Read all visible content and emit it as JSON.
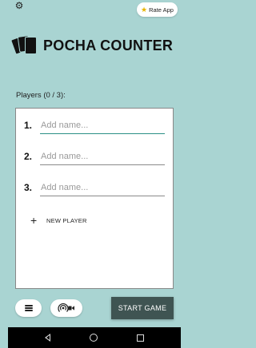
{
  "topbar": {
    "settings_icon": "gear-icon",
    "rate_app_label": "Rate App",
    "rate_icon": "star-icon",
    "rate_icon_color": "#e8b400"
  },
  "header": {
    "logo_icon": "cards-icon",
    "title": "POCHA COUNTER"
  },
  "players": {
    "label": "Players (0 / 3):",
    "rows": [
      {
        "number": "1.",
        "placeholder": "Add name...",
        "value": ""
      },
      {
        "number": "2.",
        "placeholder": "Add name...",
        "value": ""
      },
      {
        "number": "3.",
        "placeholder": "Add name...",
        "value": ""
      }
    ],
    "new_player_label": "NEW PLAYER",
    "new_player_icon": "plus-icon"
  },
  "bottom": {
    "menu_icon": "menu-icon",
    "cast_icon": "cast-broadcast-icon",
    "start_label": "START GAME"
  },
  "colors": {
    "background": "#a9d4d2",
    "accent": "#2a8f86",
    "start_button": "#3f5452"
  }
}
